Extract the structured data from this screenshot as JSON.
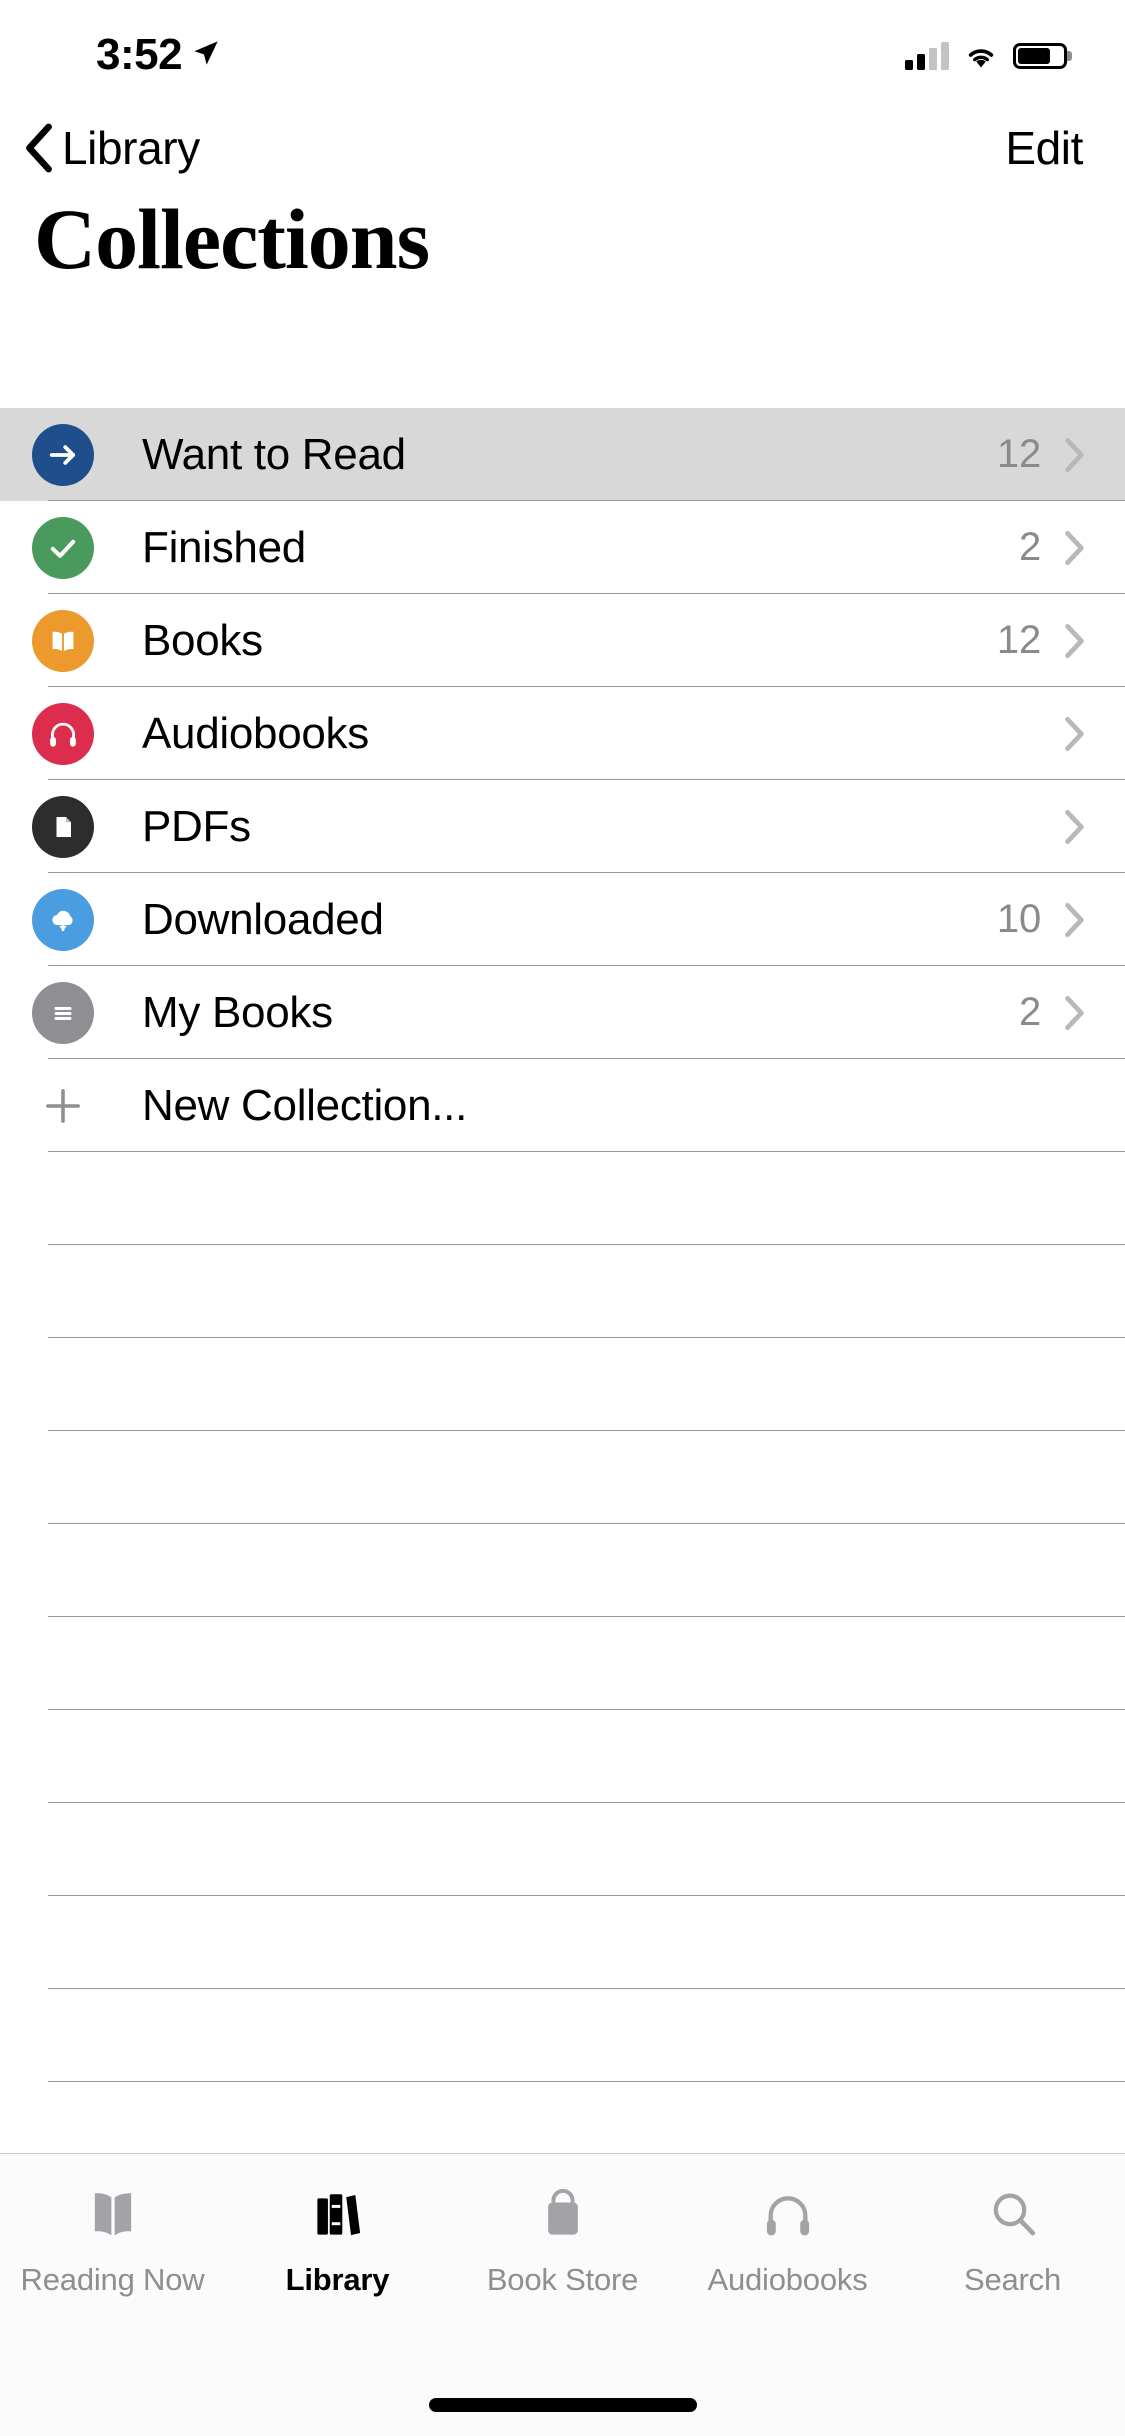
{
  "status_bar": {
    "time": "3:52",
    "location_icon": "location-arrow-icon",
    "signal_icon": "cellular-signal-icon",
    "wifi_icon": "wifi-icon",
    "battery_icon": "battery-icon"
  },
  "nav_bar": {
    "back_icon": "chevron-left-icon",
    "back_label": "Library",
    "edit_label": "Edit"
  },
  "page_title": "Collections",
  "collections": [
    {
      "label": "Want to Read",
      "count": "12",
      "icon": "arrow-right-icon",
      "color": "#1F4E8C",
      "selected": true
    },
    {
      "label": "Finished",
      "count": "2",
      "icon": "checkmark-icon",
      "color": "#4A9A5E",
      "selected": false
    },
    {
      "label": "Books",
      "count": "12",
      "icon": "open-book-icon",
      "color": "#EC9A2E",
      "selected": false
    },
    {
      "label": "Audiobooks",
      "count": "",
      "icon": "headphones-icon",
      "color": "#DC2D4E",
      "selected": false
    },
    {
      "label": "PDFs",
      "count": "",
      "icon": "document-icon",
      "color": "#2D2D2D",
      "selected": false
    },
    {
      "label": "Downloaded",
      "count": "10",
      "icon": "cloud-download-icon",
      "color": "#4A9DE0",
      "selected": false
    },
    {
      "label": "My Books",
      "count": "2",
      "icon": "list-lines-icon",
      "color": "#8E8E93",
      "selected": false
    }
  ],
  "new_collection": {
    "label": "New Collection...",
    "icon": "plus-icon"
  },
  "tab_bar": {
    "tabs": [
      {
        "label": "Reading Now",
        "icon": "open-book-tab-icon",
        "active": false
      },
      {
        "label": "Library",
        "icon": "bookshelf-tab-icon",
        "active": true
      },
      {
        "label": "Book Store",
        "icon": "shopping-bag-tab-icon",
        "active": false
      },
      {
        "label": "Audiobooks",
        "icon": "headphones-tab-icon",
        "active": false
      },
      {
        "label": "Search",
        "icon": "magnifier-tab-icon",
        "active": false
      }
    ]
  },
  "colors": {
    "selected_row_bg": "#d8d8d9",
    "separator": "#9a9a9b",
    "secondary_text": "#8a8a8e",
    "tab_inactive": "#8e8e93"
  }
}
